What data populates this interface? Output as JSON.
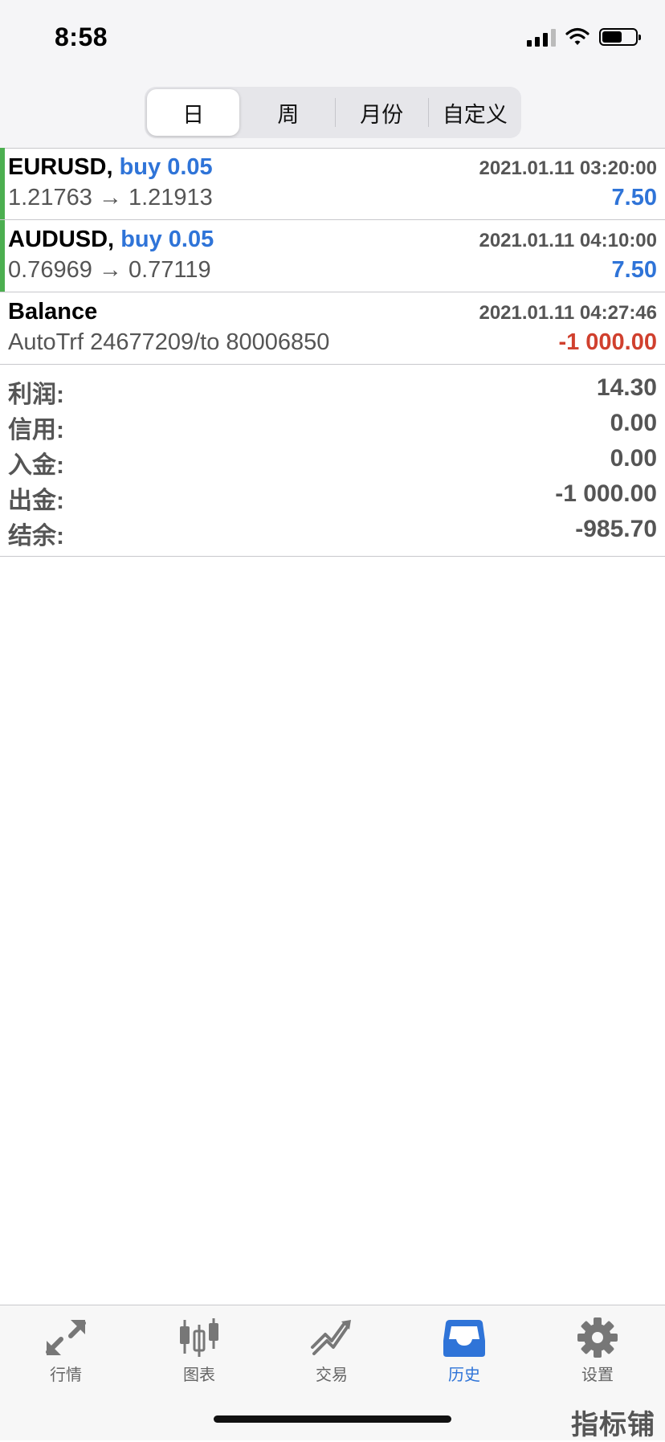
{
  "status": {
    "time": "8:58"
  },
  "segments": [
    {
      "label": "日",
      "active": true
    },
    {
      "label": "周",
      "active": false
    },
    {
      "label": "月份",
      "active": false
    },
    {
      "label": "自定义",
      "active": false
    }
  ],
  "history": [
    {
      "symbol": "EURUSD,",
      "action": "buy 0.05",
      "time": "2021.01.11 03:20:00",
      "prices": "1.21763 → 1.21913",
      "profit": "7.50"
    },
    {
      "symbol": "AUDUSD,",
      "action": "buy 0.05",
      "time": "2021.01.11 04:10:00",
      "prices": "0.76969 → 0.77119",
      "profit": "7.50"
    },
    {
      "symbol": "Balance",
      "time": "2021.01.11 04:27:46",
      "comment": "AutoTrf 24677209/to 80006850",
      "amount": "-1 000.00"
    }
  ],
  "summary": [
    {
      "label": "利润:",
      "value": "14.30"
    },
    {
      "label": "信用:",
      "value": "0.00"
    },
    {
      "label": "入金:",
      "value": "0.00"
    },
    {
      "label": "出金:",
      "value": "-1 000.00"
    },
    {
      "label": "结余:",
      "value": "-985.70"
    }
  ],
  "tabs": [
    {
      "label": "行情",
      "icon": "quotes-arrows-icon"
    },
    {
      "label": "图表",
      "icon": "candlestick-chart-icon"
    },
    {
      "label": "交易",
      "icon": "trade-trend-icon"
    },
    {
      "label": "历史",
      "icon": "history-inbox-icon",
      "active": true
    },
    {
      "label": "设置",
      "icon": "settings-gear-icon"
    }
  ],
  "colors": {
    "accent": "#2f74d8",
    "negative": "#d0402e",
    "buy_marker": "#4caf50"
  },
  "watermark": "指标铺"
}
